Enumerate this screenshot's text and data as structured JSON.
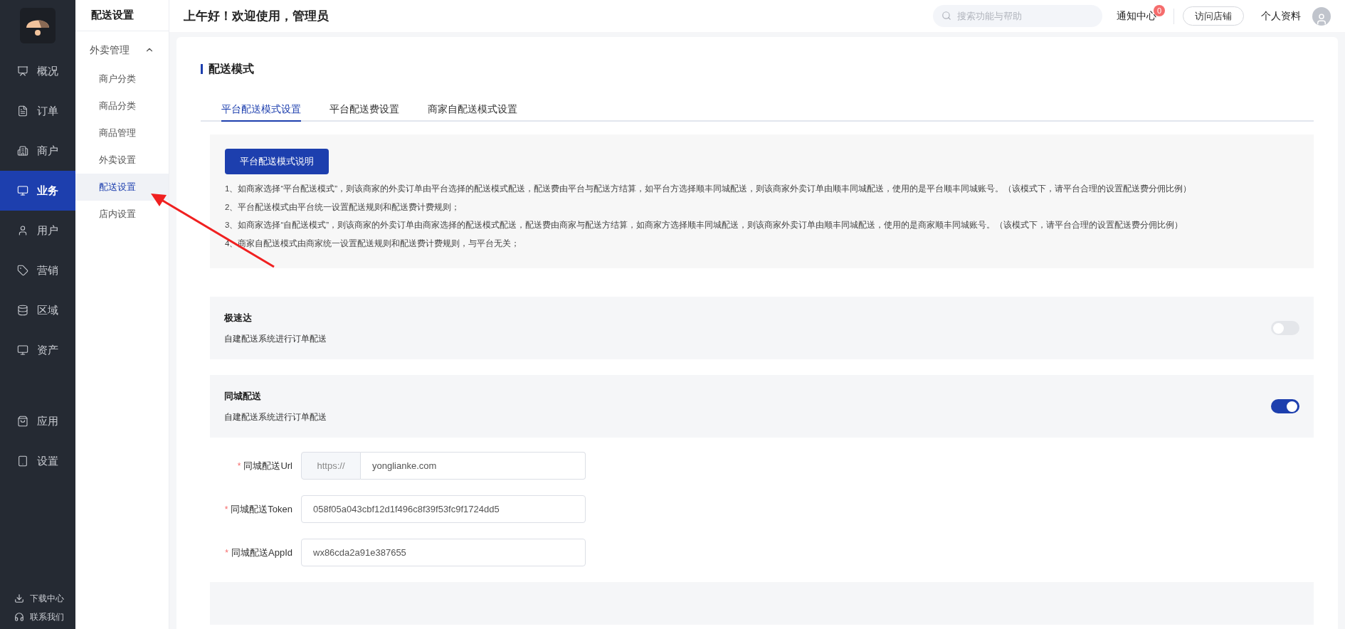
{
  "nav": [
    {
      "label": "概况",
      "selected": false
    },
    {
      "label": "订单",
      "selected": false
    },
    {
      "label": "商户",
      "selected": false
    },
    {
      "label": "业务",
      "selected": true
    },
    {
      "label": "用户",
      "selected": false
    },
    {
      "label": "营销",
      "selected": false
    },
    {
      "label": "区域",
      "selected": false
    },
    {
      "label": "资产",
      "selected": false
    }
  ],
  "nav_lower": [
    {
      "label": "应用",
      "selected": false
    },
    {
      "label": "设置",
      "selected": false
    }
  ],
  "nav_footer": [
    {
      "label": "下载中心"
    },
    {
      "label": "联系我们"
    }
  ],
  "subnav": {
    "title": "配送设置",
    "group": {
      "label": "外卖管理",
      "expanded": true,
      "children": [
        {
          "label": "商户分类",
          "selected": false
        },
        {
          "label": "商品分类",
          "selected": false
        },
        {
          "label": "商品管理",
          "selected": false
        },
        {
          "label": "外卖设置",
          "selected": false
        },
        {
          "label": "配送设置",
          "selected": true
        },
        {
          "label": "店内设置",
          "selected": false
        }
      ]
    }
  },
  "header": {
    "greeting": "上午好！欢迎使用，管理员",
    "search_placeholder": "搜索功能与帮助",
    "notifications": "通知中心",
    "notification_count": "0",
    "visit_store": "访问店铺",
    "profile": "个人资料"
  },
  "section_title": "配送模式",
  "tabs": [
    {
      "label": "平台配送模式设置",
      "selected": true
    },
    {
      "label": "平台配送费设置",
      "selected": false
    },
    {
      "label": "商家自配送模式设置",
      "selected": false
    }
  ],
  "info": {
    "button": "平台配送模式说明",
    "lines": [
      "1、如商家选择“平台配送模式”，则该商家的外卖订单由平台选择的配送模式配送，配送费由平台与配送方结算，如平台方选择顺丰同城配送，则该商家外卖订单由顺丰同城配送，使用的是平台顺丰同城账号。（该模式下，请平台合理的设置配送费分佣比例）",
      "2、平台配送模式由平台统一设置配送规则和配送费计费规则；",
      "3、如商家选择“自配送模式”，则该商家的外卖订单由商家选择的配送模式配送，配送费由商家与配送方结算，如商家方选择顺丰同城配送，则该商家外卖订单由顺丰同城配送，使用的是商家顺丰同城账号。（该模式下，请平台合理的设置配送费分佣比例）",
      "4、商家自配送模式由商家统一设置配送规则和配送费计费规则，与平台无关；"
    ]
  },
  "services": [
    {
      "name": "极速达",
      "description": "自建配送系统进行订单配送",
      "on": false
    },
    {
      "name": "同城配送",
      "description": "自建配送系统进行订单配送",
      "on": true,
      "fields": [
        {
          "label": "同城配送Url",
          "required_mark": "*",
          "prefix": "https://",
          "value": "yonglianke.com"
        },
        {
          "label": "同城配送Token",
          "required_mark": "*",
          "value": "058f05a043cbf12d1f496c8f39f53fc9f1724dd5"
        },
        {
          "label": "同城配送AppId",
          "required_mark": "*",
          "value": "wx86cda2a91e387655"
        }
      ]
    }
  ]
}
